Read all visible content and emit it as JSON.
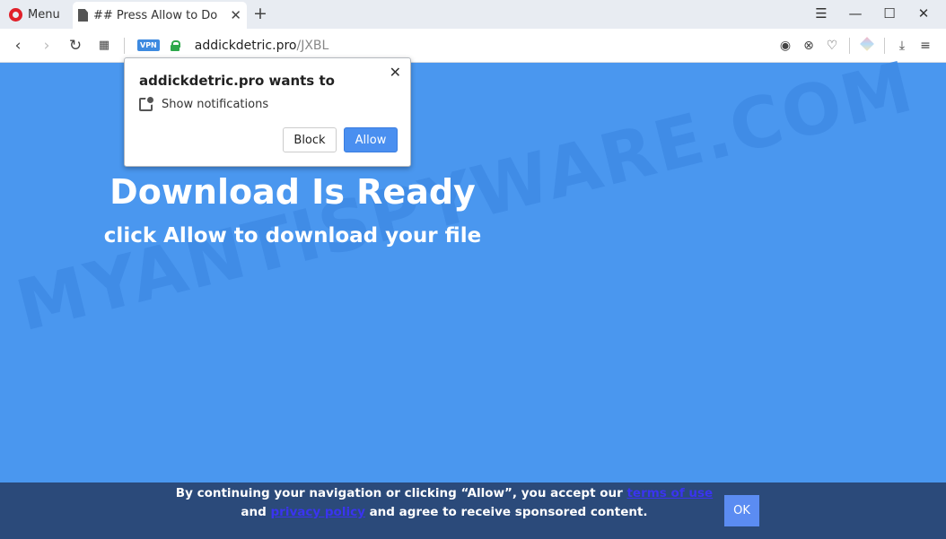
{
  "browser": {
    "menu_label": "Menu",
    "tab_title": "## Press Allow to Do",
    "vpn_label": "VPN",
    "url_host": "addickdetric.pro",
    "url_path": "/JXBL"
  },
  "page": {
    "headline": "Download Is Ready",
    "subline": "click Allow to download your file",
    "watermark": "MYANTISPYWARE.COM"
  },
  "popup": {
    "title": "addickdetric.pro wants to",
    "permission": "Show notifications",
    "block_label": "Block",
    "allow_label": "Allow"
  },
  "consent": {
    "text_1": "By continuing your navigation or clicking “Allow”, you accept our ",
    "terms_link": "terms of use",
    "text_2": " and ",
    "privacy_link": "privacy policy",
    "text_3": " and agree to receive sponsored content.",
    "ok_label": "OK"
  },
  "colors": {
    "page_background": "#4a97ef",
    "consent_background": "#2b4a7a",
    "allow_button": "#4a8ff0"
  }
}
